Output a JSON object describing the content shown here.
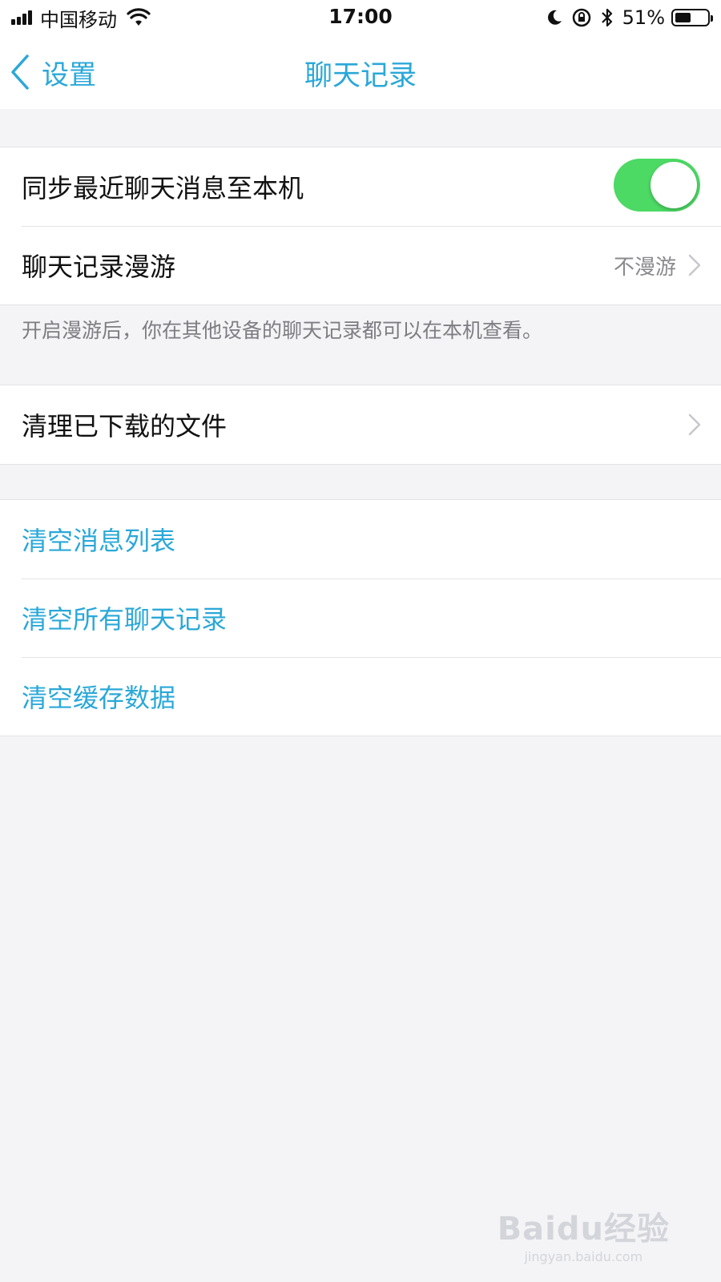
{
  "status_bar": {
    "carrier": "中国移动",
    "time": "17:00",
    "battery_percent": "51%",
    "battery_level": 0.51,
    "icons": [
      "signal-icon",
      "wifi-icon",
      "moon-icon",
      "orientation-lock-icon",
      "bluetooth-icon",
      "battery-icon"
    ]
  },
  "nav": {
    "back_label": "设置",
    "title": "聊天记录"
  },
  "section_sync": {
    "sync_label": "同步最近聊天消息至本机",
    "sync_enabled": true,
    "roaming_label": "聊天记录漫游",
    "roaming_value": "不漫游"
  },
  "footnote": "开启漫游后，你在其他设备的聊天记录都可以在本机查看。",
  "section_files": {
    "clean_files_label": "清理已下载的文件"
  },
  "section_clear": {
    "clear_message_list": "清空消息列表",
    "clear_all_records": "清空所有聊天记录",
    "clear_cache": "清空缓存数据"
  },
  "colors": {
    "accent": "#2aa8d8",
    "toggle_on": "#4cd964",
    "background": "#f4f4f6"
  },
  "watermark": {
    "logo": "Baidu经验",
    "url": "jingyan.baidu.com"
  }
}
